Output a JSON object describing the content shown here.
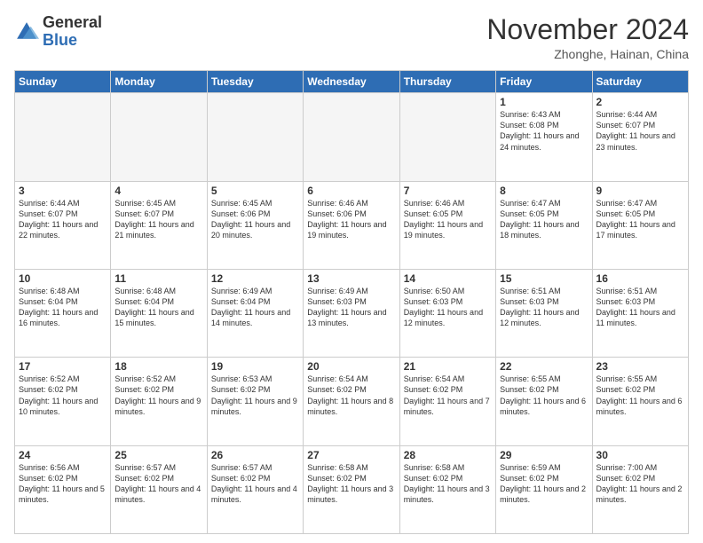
{
  "logo": {
    "general": "General",
    "blue": "Blue"
  },
  "header": {
    "month": "November 2024",
    "location": "Zhonghe, Hainan, China"
  },
  "days_of_week": [
    "Sunday",
    "Monday",
    "Tuesday",
    "Wednesday",
    "Thursday",
    "Friday",
    "Saturday"
  ],
  "weeks": [
    [
      {
        "day": "",
        "empty": true
      },
      {
        "day": "",
        "empty": true
      },
      {
        "day": "",
        "empty": true
      },
      {
        "day": "",
        "empty": true
      },
      {
        "day": "",
        "empty": true
      },
      {
        "day": "1",
        "sunrise": "6:43 AM",
        "sunset": "6:08 PM",
        "daylight": "11 hours and 24 minutes."
      },
      {
        "day": "2",
        "sunrise": "6:44 AM",
        "sunset": "6:07 PM",
        "daylight": "11 hours and 23 minutes."
      }
    ],
    [
      {
        "day": "3",
        "sunrise": "6:44 AM",
        "sunset": "6:07 PM",
        "daylight": "11 hours and 22 minutes."
      },
      {
        "day": "4",
        "sunrise": "6:45 AM",
        "sunset": "6:07 PM",
        "daylight": "11 hours and 21 minutes."
      },
      {
        "day": "5",
        "sunrise": "6:45 AM",
        "sunset": "6:06 PM",
        "daylight": "11 hours and 20 minutes."
      },
      {
        "day": "6",
        "sunrise": "6:46 AM",
        "sunset": "6:06 PM",
        "daylight": "11 hours and 19 minutes."
      },
      {
        "day": "7",
        "sunrise": "6:46 AM",
        "sunset": "6:05 PM",
        "daylight": "11 hours and 19 minutes."
      },
      {
        "day": "8",
        "sunrise": "6:47 AM",
        "sunset": "6:05 PM",
        "daylight": "11 hours and 18 minutes."
      },
      {
        "day": "9",
        "sunrise": "6:47 AM",
        "sunset": "6:05 PM",
        "daylight": "11 hours and 17 minutes."
      }
    ],
    [
      {
        "day": "10",
        "sunrise": "6:48 AM",
        "sunset": "6:04 PM",
        "daylight": "11 hours and 16 minutes."
      },
      {
        "day": "11",
        "sunrise": "6:48 AM",
        "sunset": "6:04 PM",
        "daylight": "11 hours and 15 minutes."
      },
      {
        "day": "12",
        "sunrise": "6:49 AM",
        "sunset": "6:04 PM",
        "daylight": "11 hours and 14 minutes."
      },
      {
        "day": "13",
        "sunrise": "6:49 AM",
        "sunset": "6:03 PM",
        "daylight": "11 hours and 13 minutes."
      },
      {
        "day": "14",
        "sunrise": "6:50 AM",
        "sunset": "6:03 PM",
        "daylight": "11 hours and 12 minutes."
      },
      {
        "day": "15",
        "sunrise": "6:51 AM",
        "sunset": "6:03 PM",
        "daylight": "11 hours and 12 minutes."
      },
      {
        "day": "16",
        "sunrise": "6:51 AM",
        "sunset": "6:03 PM",
        "daylight": "11 hours and 11 minutes."
      }
    ],
    [
      {
        "day": "17",
        "sunrise": "6:52 AM",
        "sunset": "6:02 PM",
        "daylight": "11 hours and 10 minutes."
      },
      {
        "day": "18",
        "sunrise": "6:52 AM",
        "sunset": "6:02 PM",
        "daylight": "11 hours and 9 minutes."
      },
      {
        "day": "19",
        "sunrise": "6:53 AM",
        "sunset": "6:02 PM",
        "daylight": "11 hours and 9 minutes."
      },
      {
        "day": "20",
        "sunrise": "6:54 AM",
        "sunset": "6:02 PM",
        "daylight": "11 hours and 8 minutes."
      },
      {
        "day": "21",
        "sunrise": "6:54 AM",
        "sunset": "6:02 PM",
        "daylight": "11 hours and 7 minutes."
      },
      {
        "day": "22",
        "sunrise": "6:55 AM",
        "sunset": "6:02 PM",
        "daylight": "11 hours and 6 minutes."
      },
      {
        "day": "23",
        "sunrise": "6:55 AM",
        "sunset": "6:02 PM",
        "daylight": "11 hours and 6 minutes."
      }
    ],
    [
      {
        "day": "24",
        "sunrise": "6:56 AM",
        "sunset": "6:02 PM",
        "daylight": "11 hours and 5 minutes."
      },
      {
        "day": "25",
        "sunrise": "6:57 AM",
        "sunset": "6:02 PM",
        "daylight": "11 hours and 4 minutes."
      },
      {
        "day": "26",
        "sunrise": "6:57 AM",
        "sunset": "6:02 PM",
        "daylight": "11 hours and 4 minutes."
      },
      {
        "day": "27",
        "sunrise": "6:58 AM",
        "sunset": "6:02 PM",
        "daylight": "11 hours and 3 minutes."
      },
      {
        "day": "28",
        "sunrise": "6:58 AM",
        "sunset": "6:02 PM",
        "daylight": "11 hours and 3 minutes."
      },
      {
        "day": "29",
        "sunrise": "6:59 AM",
        "sunset": "6:02 PM",
        "daylight": "11 hours and 2 minutes."
      },
      {
        "day": "30",
        "sunrise": "7:00 AM",
        "sunset": "6:02 PM",
        "daylight": "11 hours and 2 minutes."
      }
    ]
  ]
}
